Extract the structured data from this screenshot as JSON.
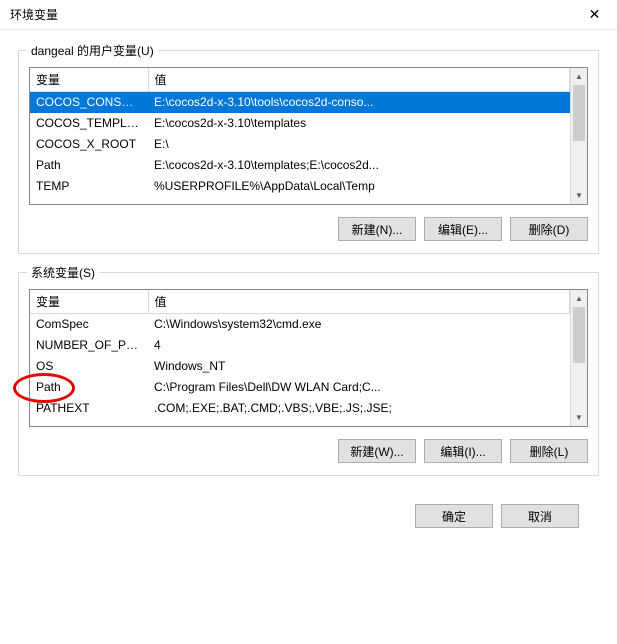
{
  "window": {
    "title": "环境变量"
  },
  "userSection": {
    "legend": "dangeal 的用户变量(U)",
    "headers": {
      "name": "变量",
      "value": "值"
    },
    "rows": [
      {
        "name": "COCOS_CONSOL...",
        "value": "E:\\cocos2d-x-3.10\\tools\\cocos2d-conso...",
        "selected": true
      },
      {
        "name": "COCOS_TEMPLA...",
        "value": "E:\\cocos2d-x-3.10\\templates",
        "selected": false
      },
      {
        "name": "COCOS_X_ROOT",
        "value": "E:\\",
        "selected": false
      },
      {
        "name": "Path",
        "value": "E:\\cocos2d-x-3.10\\templates;E:\\cocos2d...",
        "selected": false
      },
      {
        "name": "TEMP",
        "value": "%USERPROFILE%\\AppData\\Local\\Temp",
        "selected": false
      }
    ],
    "buttons": {
      "new": "新建(N)...",
      "edit": "编辑(E)...",
      "delete": "删除(D)"
    }
  },
  "systemSection": {
    "legend": "系统变量(S)",
    "headers": {
      "name": "变量",
      "value": "值"
    },
    "rows": [
      {
        "name": "ComSpec",
        "value": "C:\\Windows\\system32\\cmd.exe"
      },
      {
        "name": "NUMBER_OF_PR...",
        "value": "4"
      },
      {
        "name": "OS",
        "value": "Windows_NT"
      },
      {
        "name": "Path",
        "value": "C:\\Program Files\\Dell\\DW WLAN Card;C..."
      },
      {
        "name": "PATHEXT",
        "value": ".COM;.EXE;.BAT;.CMD;.VBS;.VBE;.JS;.JSE;"
      }
    ],
    "buttons": {
      "new": "新建(W)...",
      "edit": "编辑(I)...",
      "delete": "删除(L)"
    }
  },
  "footer": {
    "ok": "确定",
    "cancel": "取消"
  }
}
